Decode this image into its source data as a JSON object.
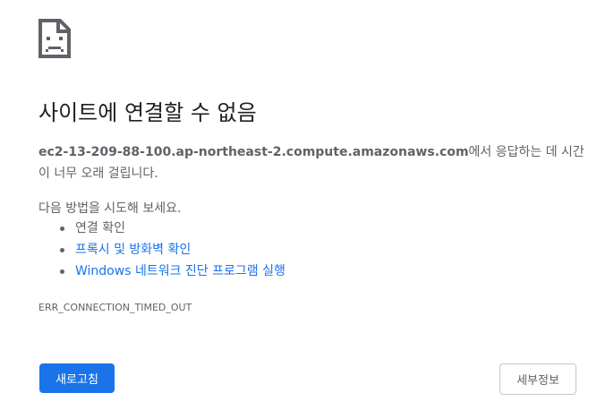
{
  "error": {
    "icon": "sad-page-icon",
    "title": "사이트에 연결할 수 없음",
    "host": "ec2-13-209-88-100.ap-northeast-2.compute.amazonaws.com",
    "description_suffix": "에서 응답하는 데 시간이 너무 오래 걸립니다.",
    "try_intro": "다음 방법을 시도해 보세요.",
    "suggestions": [
      {
        "label": "연결 확인",
        "is_link": false
      },
      {
        "label": "프록시 및 방화벽 확인",
        "is_link": true
      },
      {
        "label": "Windows 네트워크 진단 프로그램 실행",
        "is_link": true
      }
    ],
    "code": "ERR_CONNECTION_TIMED_OUT"
  },
  "buttons": {
    "reload_label": "새로고침",
    "details_label": "세부정보"
  },
  "colors": {
    "accent": "#1a73e8",
    "text_primary": "#202124",
    "text_secondary": "#5f6368",
    "border": "#c6c6c6"
  }
}
